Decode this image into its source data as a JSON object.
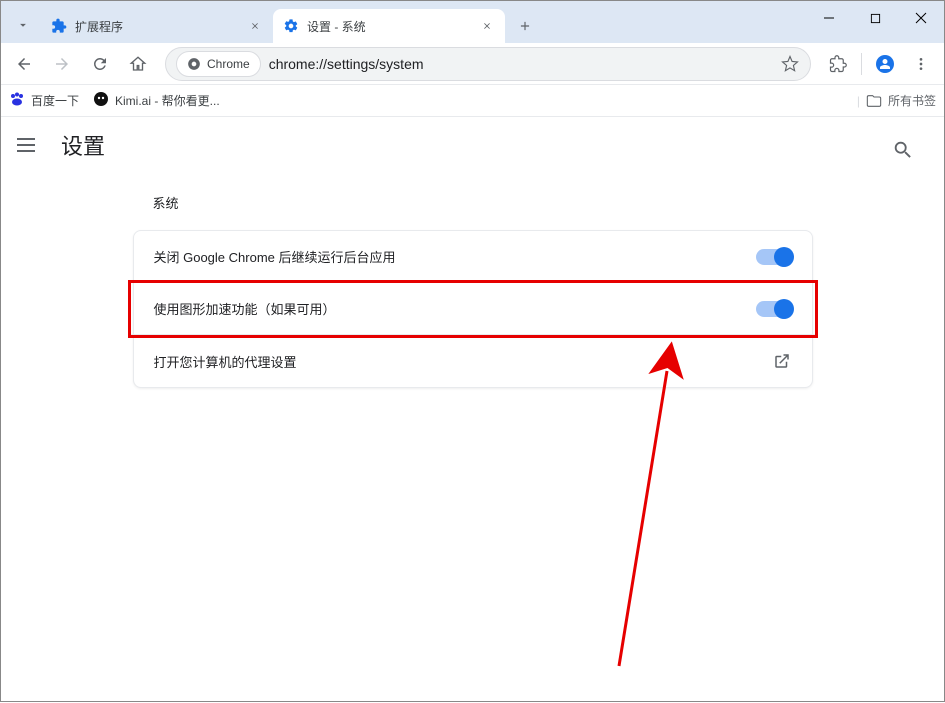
{
  "tabs": [
    {
      "title": "扩展程序",
      "favicon": "puzzle"
    },
    {
      "title": "设置 - 系统",
      "favicon": "gear"
    }
  ],
  "toolbar": {
    "chrome_chip": "Chrome",
    "url": "chrome://settings/system"
  },
  "bookmarks": {
    "items": [
      {
        "label": "百度一下",
        "icon": "baidu"
      },
      {
        "label": "Kimi.ai - 帮你看更...",
        "icon": "kimi"
      }
    ],
    "all_label": "所有书签"
  },
  "settings": {
    "page_title": "设置",
    "section_label": "系统",
    "rows": [
      {
        "label": "关闭 Google Chrome 后继续运行后台应用",
        "type": "toggle",
        "on": true
      },
      {
        "label": "使用图形加速功能（如果可用）",
        "type": "toggle",
        "on": true,
        "highlighted": true
      },
      {
        "label": "打开您计算机的代理设置",
        "type": "launch"
      }
    ]
  }
}
